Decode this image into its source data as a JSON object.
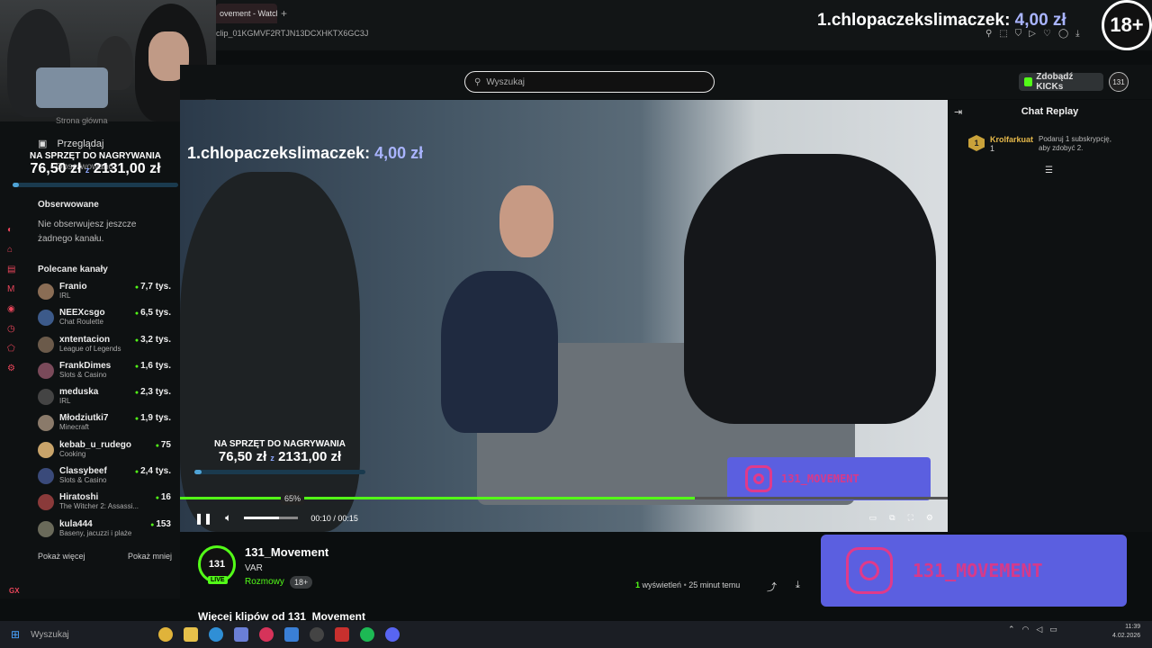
{
  "browser": {
    "tab_title": "ovement - Watch",
    "new_tab": "+",
    "url": "clip_01KGMVF2RTJN13DCXHKTX6GC3J"
  },
  "overlay": {
    "top_donation_user": "1.chlopaczekslimaczek:",
    "top_donation_amount": "4,00 zł",
    "age_badge": "18+",
    "goal_label": "NA SPRZĘT DO NAGRYWANIA",
    "goal_current": "76,50 zł",
    "goal_sep": "z",
    "goal_target": "2131,00 zł",
    "goal_progress": 0.04,
    "instagram_handle_small": "131_MOVEMENT",
    "instagram_handle_big": "131_MOVEMENT"
  },
  "header": {
    "search_placeholder": "Wyszukaj",
    "get_kicks_label": "Zdobądź KICKs",
    "avatar_text": "131"
  },
  "sidebar": {
    "partial_item": "Strona główna",
    "browse_label": "Przeglądaj",
    "followed_nav_label": "Obserwowane",
    "followed_title": "Obserwowane",
    "followed_empty": "Nie obserwujesz jeszcze żadnego kanału.",
    "recommended_title": "Polecane kanały",
    "channels": [
      {
        "name": "Franio",
        "category": "IRL",
        "viewers": "7,7 tys."
      },
      {
        "name": "NEEXcsgo",
        "category": "Chat Roulette",
        "viewers": "6,5 tys."
      },
      {
        "name": "xntentacion",
        "category": "League of Legends",
        "viewers": "3,2 tys."
      },
      {
        "name": "FrankDimes",
        "category": "Slots & Casino",
        "viewers": "1,6 tys."
      },
      {
        "name": "meduska",
        "category": "IRL",
        "viewers": "2,3 tys."
      },
      {
        "name": "Młodziutki7",
        "category": "Minecraft",
        "viewers": "1,9 tys."
      },
      {
        "name": "kebab_u_rudego",
        "category": "Cooking",
        "viewers": "75"
      },
      {
        "name": "Classybeef",
        "category": "Slots & Casino",
        "viewers": "2,4 tys."
      },
      {
        "name": "Hiratoshi",
        "category": "The Witcher 2: Assassi...",
        "viewers": "16"
      },
      {
        "name": "kula444",
        "category": "Baseny, jacuzzi i plaże",
        "viewers": "153"
      }
    ],
    "show_more": "Pokaż więcej",
    "show_less": "Pokaż mniej"
  },
  "player": {
    "time_current": "00:10",
    "time_sep": "/",
    "time_total": "00:15",
    "volume_tip": "65%",
    "volume_level": 0.65,
    "playback_progress": 0.67
  },
  "clip": {
    "channel_name": "131_Movement",
    "title": "VAR",
    "category": "Rozmowy",
    "age_chip": "18+",
    "live_badge": "LIVE",
    "channel_logo_text": "131",
    "views_count": "1",
    "views_label": "wyświetleń",
    "time_ago": "25 minut temu",
    "more_clips": "Więcej klipów od 131_Movement"
  },
  "chat": {
    "title": "Chat Replay",
    "message": {
      "badge": "1",
      "user": "Krolfarkuat",
      "count": "1",
      "text": "Podaruj 1 subskrypcję, aby zdobyć 2."
    }
  },
  "taskbar": {
    "search_placeholder": "Wyszukaj",
    "clock_time": "11:39",
    "clock_date": "4.02.2026"
  },
  "colors": {
    "kick_green": "#53fc18",
    "donation_amount": "#a9b4ff",
    "instagram_bg": "#5b5fe0",
    "instagram_fg": "#e03a8a",
    "nav_icon": "#e9455a"
  },
  "icons": [
    "search-icon",
    "pause-icon",
    "volume-icon",
    "theater-icon",
    "pip-icon",
    "fullscreen-icon",
    "settings-icon",
    "share-icon",
    "download-icon",
    "chat-collapse-icon",
    "chat-filter-icon",
    "browse-icon",
    "instagram-icon"
  ]
}
